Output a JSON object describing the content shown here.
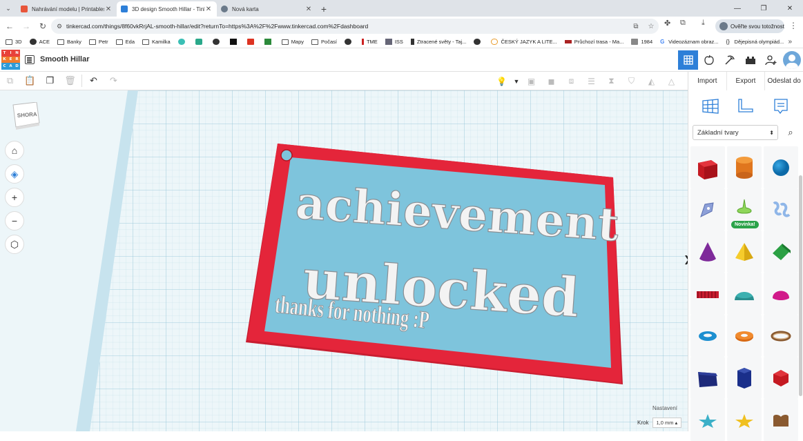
{
  "browser": {
    "tabs": [
      {
        "title": "Nahrávání modelu | Printables.c",
        "active": false,
        "favicon_color": "#e8553a"
      },
      {
        "title": "3D design Smooth Hillar - Tinke",
        "active": true,
        "favicon_color": "#2d7fd8"
      },
      {
        "title": "Nová karta",
        "active": false,
        "favicon_color": "#6b7a8a"
      }
    ],
    "url": "tinkercad.com/things/8f60vkRrjAL-smooth-hillar/edit?returnTo=https%3A%2F%2Fwww.tinkercad.com%2Fdashboard",
    "identity_label": "Ověřte svou totožnost",
    "bookmarks": [
      "3D",
      "ACE",
      "Banky",
      "Petr",
      "Eda",
      "Kamilka",
      "",
      "",
      "",
      "",
      "",
      "",
      "Mapy",
      "Počasí",
      "",
      "TME",
      "ISS",
      "Ztracené světy - Taj...",
      "",
      "ČESKÝ JAZYK A LITE...",
      "Průchozí trasa - Ma...",
      "1984",
      "Videozáznam obraz...",
      "Dějepisná olympiád..."
    ]
  },
  "app": {
    "design_title": "Smooth Hillar",
    "logo_letters": [
      "T",
      "I",
      "N",
      "K",
      "E",
      "R",
      "C",
      "A",
      "D"
    ],
    "logo_colors": [
      "#e8413a",
      "#e8413a",
      "#e8413a",
      "#f07d2e",
      "#f07d2e",
      "#f07d2e",
      "#2d9bd8",
      "#2d9bd8",
      "#2d9bd8"
    ]
  },
  "panel": {
    "import_label": "Import",
    "export_label": "Export",
    "send_label": "Odeslat do",
    "category": "Základní tvary",
    "new_badge": "Novinka!",
    "shapes": [
      "box",
      "cylinder",
      "sphere",
      "scribble",
      "paraboloid",
      "text-shape",
      "cone",
      "pyramid",
      "roof",
      "text-block",
      "half-sphere",
      "paraboloid-magenta",
      "torus",
      "tube",
      "ring",
      "wedge-navy",
      "hexagonal-prism",
      "icosahedron",
      "star-teal",
      "star-yellow",
      "heart-brown"
    ]
  },
  "workplane": {
    "view_cube_label": "SHORA",
    "settings_label": "Nastavení",
    "snap_label": "Krok",
    "snap_value": "1,0 mm"
  },
  "model": {
    "line1": "achievement",
    "line2": "unlocked",
    "line3": "thanks for nothing :P",
    "frame_color": "#e4253a",
    "plate_color": "#7ec4dc",
    "text_color": "#f3f3f3"
  }
}
